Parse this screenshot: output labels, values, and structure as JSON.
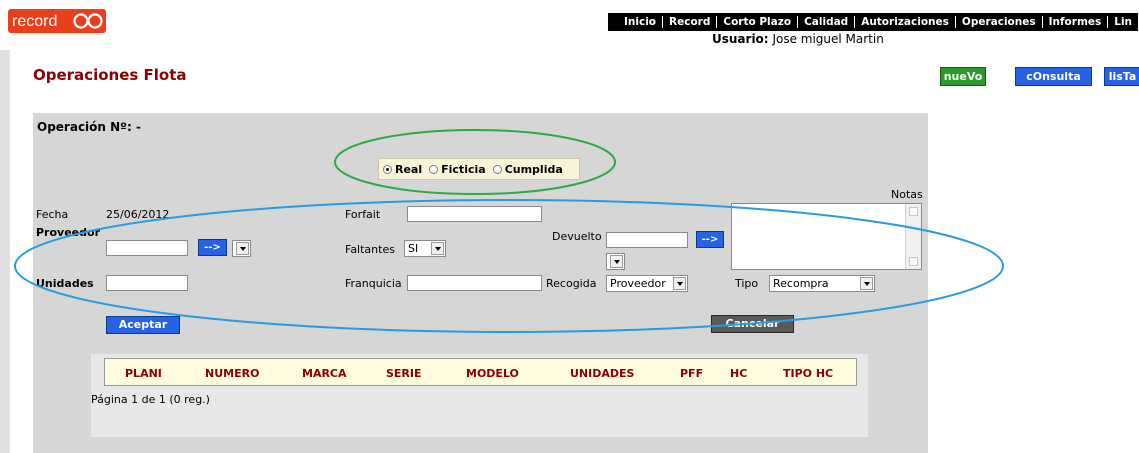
{
  "logo": {
    "text_a": "record",
    "text_b": "go",
    "colors": {
      "background": "#e8401c",
      "text": "#ffffff"
    }
  },
  "nav": {
    "items": [
      "Inicio",
      "Record",
      "Corto Plazo",
      "Calidad",
      "Autorizaciones",
      "Operaciones",
      "Informes",
      "Lin"
    ]
  },
  "user": {
    "label": "Usuario:",
    "name": "Jose miguel Martin"
  },
  "page": {
    "title": "Operaciones Flota"
  },
  "toolbar": {
    "new_label": "nueVo",
    "query_label": "cOnsulta",
    "list_label": "lisTa"
  },
  "form": {
    "operation_label": "Operación Nº:",
    "operation_value": "-",
    "radios": {
      "real": "Real",
      "ficticia": "Ficticia",
      "cumplida": "Cumplida",
      "selected": "Real"
    },
    "notas_label": "Notas",
    "fecha_label": "Fecha",
    "fecha_value": "25/06/2012",
    "proveedor_label": "Proveedor",
    "unidades_label": "Unidades",
    "forfait_label": "Forfait",
    "faltantes_label": "Faltantes",
    "faltantes_value": "SI",
    "franquicia_label": "Franquicia",
    "devuelto_label": "Devuelto",
    "recogida_label": "Recogida",
    "recogida_value": "Proveedor",
    "tipo_label": "Tipo",
    "tipo_value": "Recompra",
    "arrow_btn": "-->",
    "accept_label": "Aceptar",
    "cancel_label": "Cancelar"
  },
  "grid": {
    "columns": [
      "PLANI",
      "NUMERO",
      "MARCA",
      "SERIE",
      "MODELO",
      "UNIDADES",
      "PFF",
      "HC",
      "TIPO HC"
    ],
    "pager": "Página 1 de 1 (0 reg.)"
  },
  "colors": {
    "title": "#8b0000",
    "accent_blue": "#2762e6",
    "accent_green": "#2b9a2b",
    "annotation_green": "#2ea84a",
    "annotation_blue": "#2a9be0"
  }
}
